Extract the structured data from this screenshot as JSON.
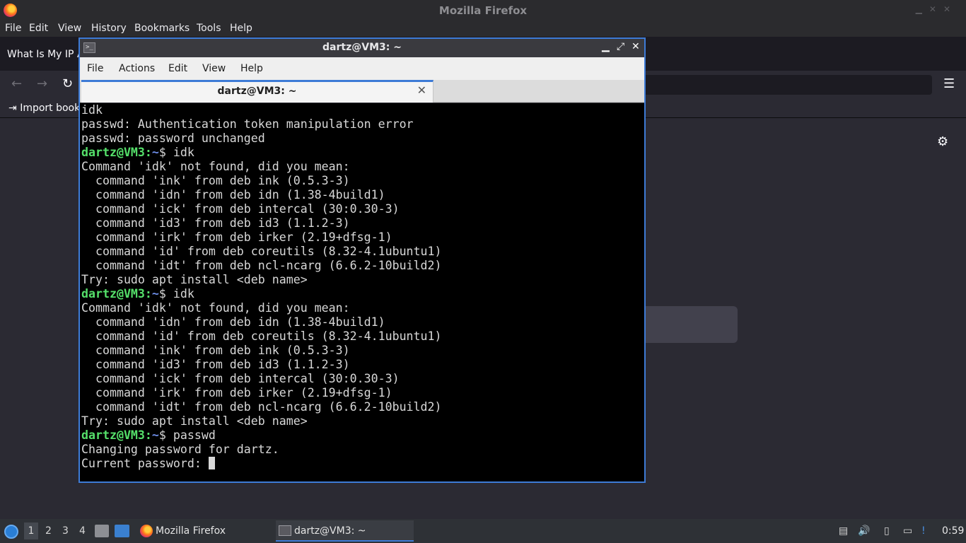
{
  "firefox": {
    "title": "Mozilla Firefox",
    "menu": [
      "File",
      "Edit",
      "View",
      "History",
      "Bookmarks",
      "Tools",
      "Help"
    ],
    "tab_title": "What Is My IP A",
    "bookmark_import": "Import book"
  },
  "terminal": {
    "title": "dartz@VM3: ~",
    "menu": [
      "File",
      "Actions",
      "Edit",
      "View",
      "Help"
    ],
    "tab_label": "dartz@VM3: ~",
    "prompt_user": "dartz@VM3",
    "prompt_path": "~",
    "lines": [
      {
        "t": "out",
        "text": "idk"
      },
      {
        "t": "out",
        "text": "passwd: Authentication token manipulation error"
      },
      {
        "t": "out",
        "text": "passwd: password unchanged"
      },
      {
        "t": "cmd",
        "text": "$ idk"
      },
      {
        "t": "out",
        "text": "Command 'idk' not found, did you mean:"
      },
      {
        "t": "out",
        "text": "  command 'ink' from deb ink (0.5.3-3)"
      },
      {
        "t": "out",
        "text": "  command 'idn' from deb idn (1.38-4build1)"
      },
      {
        "t": "out",
        "text": "  command 'ick' from deb intercal (30:0.30-3)"
      },
      {
        "t": "out",
        "text": "  command 'id3' from deb id3 (1.1.2-3)"
      },
      {
        "t": "out",
        "text": "  command 'irk' from deb irker (2.19+dfsg-1)"
      },
      {
        "t": "out",
        "text": "  command 'id' from deb coreutils (8.32-4.1ubuntu1)"
      },
      {
        "t": "out",
        "text": "  command 'idt' from deb ncl-ncarg (6.6.2-10build2)"
      },
      {
        "t": "out",
        "text": "Try: sudo apt install <deb name>"
      },
      {
        "t": "cmd",
        "text": "$ idk"
      },
      {
        "t": "out",
        "text": "Command 'idk' not found, did you mean:"
      },
      {
        "t": "out",
        "text": "  command 'idn' from deb idn (1.38-4build1)"
      },
      {
        "t": "out",
        "text": "  command 'id' from deb coreutils (8.32-4.1ubuntu1)"
      },
      {
        "t": "out",
        "text": "  command 'ink' from deb ink (0.5.3-3)"
      },
      {
        "t": "out",
        "text": "  command 'id3' from deb id3 (1.1.2-3)"
      },
      {
        "t": "out",
        "text": "  command 'ick' from deb intercal (30:0.30-3)"
      },
      {
        "t": "out",
        "text": "  command 'irk' from deb irker (2.19+dfsg-1)"
      },
      {
        "t": "out",
        "text": "  command 'idt' from deb ncl-ncarg (6.6.2-10build2)"
      },
      {
        "t": "out",
        "text": "Try: sudo apt install <deb name>"
      },
      {
        "t": "cmd",
        "text": "$ passwd"
      },
      {
        "t": "out",
        "text": "Changing password for dartz."
      },
      {
        "t": "cur",
        "text": "Current password: "
      }
    ]
  },
  "taskbar": {
    "workspaces": [
      "1",
      "2",
      "3",
      "4"
    ],
    "tasks": [
      {
        "label": "Mozilla Firefox",
        "icon": "firefox-icon"
      },
      {
        "label": "dartz@VM3: ~",
        "icon": "terminal-icon"
      }
    ],
    "clock": "0:59"
  },
  "colors": {
    "accent": "#3d7bd6",
    "prompt_user": "#55e06a",
    "prompt_path": "#6e8ee8"
  }
}
